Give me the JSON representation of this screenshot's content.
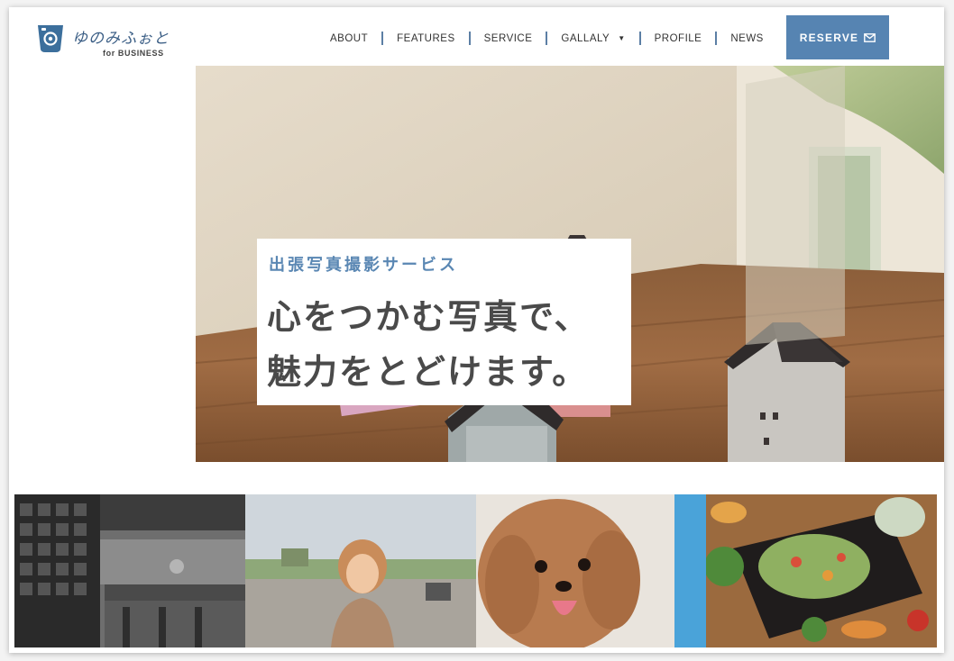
{
  "brand": {
    "logo_text": "ゆのみふぉと",
    "logo_sub": "for BUSINESS",
    "logo_icon": "cup-camera-icon",
    "brand_color": "#3c5f86"
  },
  "nav": {
    "items": [
      {
        "label": "ABOUT"
      },
      {
        "label": "FEATURES"
      },
      {
        "label": "SERVICE"
      },
      {
        "label": "GALLALY",
        "has_dropdown": true
      },
      {
        "label": "PROFILE"
      },
      {
        "label": "NEWS"
      }
    ],
    "separator_color": "#5c7fa5"
  },
  "reserve": {
    "label": "RESERVE",
    "icon": "envelope-icon",
    "color": "#5684b2"
  },
  "hero": {
    "subtitle": "出張写真撮影サービス",
    "headline_line1": "心をつかむ写真で、",
    "headline_line2": "魅力をとどけます。",
    "image": "miniature-wooden-houses-photo",
    "subtitle_color": "#5a87b3"
  },
  "gallery": {
    "items": [
      {
        "image": "restaurant-interior-bw-photo"
      },
      {
        "image": "smiling-woman-portrait-photo"
      },
      {
        "image": "toy-poodle-dog-photo"
      },
      {
        "image": "salad-dish-photo"
      }
    ]
  }
}
